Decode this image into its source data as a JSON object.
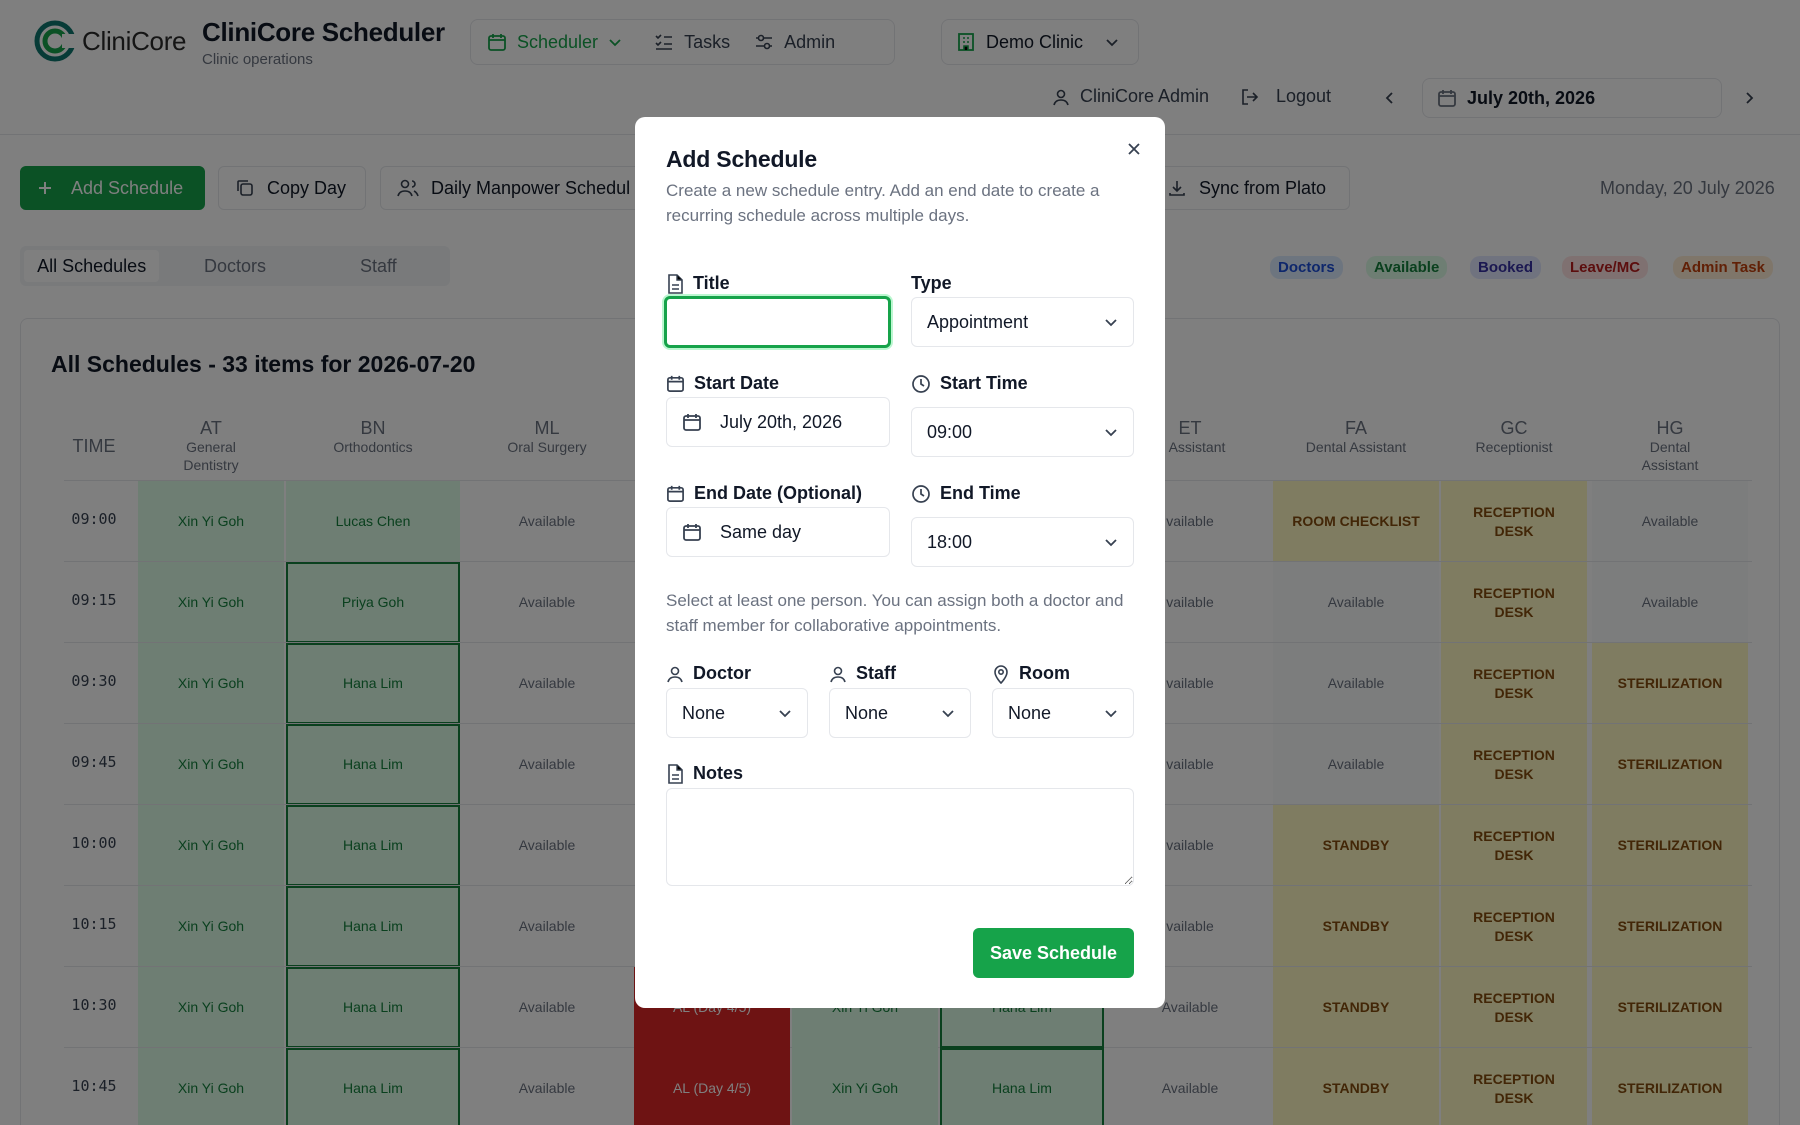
{
  "header": {
    "logo_text": "CliniCore",
    "title": "CliniCore Scheduler",
    "subtitle": "Clinic operations",
    "nav": {
      "scheduler": "Scheduler",
      "tasks": "Tasks",
      "admin": "Admin"
    },
    "clinic": "Demo Clinic",
    "user": "CliniCore Admin",
    "logout": "Logout",
    "date": "July 20th, 2026"
  },
  "toolbar": {
    "add": "Add Schedule",
    "copy": "Copy Day",
    "manpower": "Daily Manpower Schedul",
    "sync": "Sync from Plato",
    "today": "Monday, 20 July 2026"
  },
  "tabs": [
    "All Schedules",
    "Doctors",
    "Staff"
  ],
  "legend": {
    "doctors": "Doctors",
    "available": "Available",
    "booked": "Booked",
    "leave": "Leave/MC",
    "admin": "Admin Task"
  },
  "grid": {
    "title": "All Schedules - 33 items for 2026-07-20",
    "time_label": "TIME",
    "times": [
      "09:00",
      "09:15",
      "09:30",
      "09:45",
      "10:00",
      "10:15",
      "10:30",
      "10:45"
    ],
    "columns": [
      {
        "abbr": "AT",
        "role": "General Dentistry"
      },
      {
        "abbr": "BN",
        "role": "Orthodontics"
      },
      {
        "abbr": "ML",
        "role": "Oral Surgery"
      },
      {
        "abbr": "ET",
        "role": "al Assistant"
      },
      {
        "abbr": "FA",
        "role": "Dental Assistant"
      },
      {
        "abbr": "GC",
        "role": "Receptionist"
      },
      {
        "abbr": "HG",
        "role": "Dental Assistant"
      }
    ],
    "at": [
      "Xin Yi Goh",
      "Xin Yi Goh",
      "Xin Yi Goh",
      "Xin Yi Goh",
      "Xin Yi Goh",
      "Xin Yi Goh",
      "Xin Yi Goh",
      "Xin Yi Goh"
    ],
    "bn": [
      "Lucas Chen",
      "Priya Goh",
      "Hana Lim",
      "Hana Lim",
      "Hana Lim",
      "Hana Lim",
      "Hana Lim",
      "Hana Lim"
    ],
    "ml": [
      "Available",
      "Available",
      "Available",
      "Available",
      "Available",
      "Available",
      "Available",
      "Available"
    ],
    "et": [
      "vailable",
      "vailable",
      "vailable",
      "vailable",
      "vailable",
      "vailable",
      "Available",
      "Available"
    ],
    "fa": [
      "ROOM CHECKLIST",
      "Available",
      "Available",
      "Available",
      "STANDBY",
      "STANDBY",
      "STANDBY",
      "STANDBY"
    ],
    "gc": [
      "RECEPTION DESK",
      "RECEPTION DESK",
      "RECEPTION DESK",
      "RECEPTION DESK",
      "RECEPTION DESK",
      "RECEPTION DESK",
      "RECEPTION DESK",
      "RECEPTION DESK"
    ],
    "hg": [
      "Available",
      "Available",
      "STERILIZATION",
      "STERILIZATION",
      "STERILIZATION",
      "STERILIZATION",
      "STERILIZATION",
      "STERILIZATION"
    ],
    "hidden_row_1030": [
      "AL (Day 4/5)",
      "Xin Yi Goh",
      "Hana Lim"
    ],
    "hidden_row_1045": [
      "AL (Day 4/5)",
      "Xin Yi Goh",
      "Hana Lim"
    ]
  },
  "modal": {
    "title": "Add Schedule",
    "description": "Create a new schedule entry. Add an end date to create a recurring schedule across multiple days.",
    "title_label": "Title",
    "title_value": "",
    "type_label": "Type",
    "type_value": "Appointment",
    "start_date_label": "Start Date",
    "start_date_value": "July 20th, 2026",
    "start_time_label": "Start Time",
    "start_time_value": "09:00",
    "end_date_label": "End Date (Optional)",
    "end_date_value": "Same day",
    "end_time_label": "End Time",
    "end_time_value": "18:00",
    "assign_note": "Select at least one person. You can assign both a doctor and staff member for collaborative appointments.",
    "doctor_label": "Doctor",
    "doctor_value": "None",
    "staff_label": "Staff",
    "staff_value": "None",
    "room_label": "Room",
    "room_value": "None",
    "notes_label": "Notes",
    "notes_value": "",
    "save": "Save Schedule"
  }
}
